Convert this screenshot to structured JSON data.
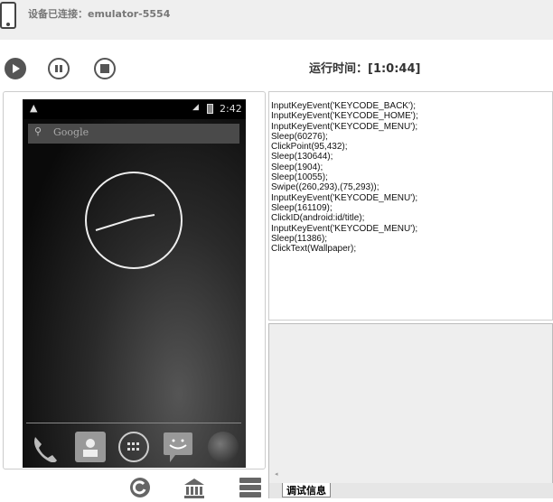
{
  "header": {
    "connection_status": "设备已连接：emulator-5554"
  },
  "toolbar": {
    "runtime": "运行时间：[1:0:44]"
  },
  "phone": {
    "time": "2:42",
    "search_placeholder": "Google"
  },
  "script": {
    "lines": [
      "InputKeyEvent('KEYCODE_BACK');",
      "InputKeyEvent('KEYCODE_HOME');",
      "InputKeyEvent('KEYCODE_MENU');",
      "Sleep(60276);",
      "ClickPoint(95,432);",
      "Sleep(130644);",
      "Sleep(1904);",
      "Sleep(10055);",
      "Swipe((260,293),(75,293));",
      "InputKeyEvent('KEYCODE_MENU');",
      "Sleep(161109);",
      "ClickID(android:id/title);",
      "InputKeyEvent('KEYCODE_MENU');",
      "Sleep(11386);",
      "ClickText(Wallpaper);"
    ]
  },
  "debug": {
    "tab_label": "调试信息"
  }
}
